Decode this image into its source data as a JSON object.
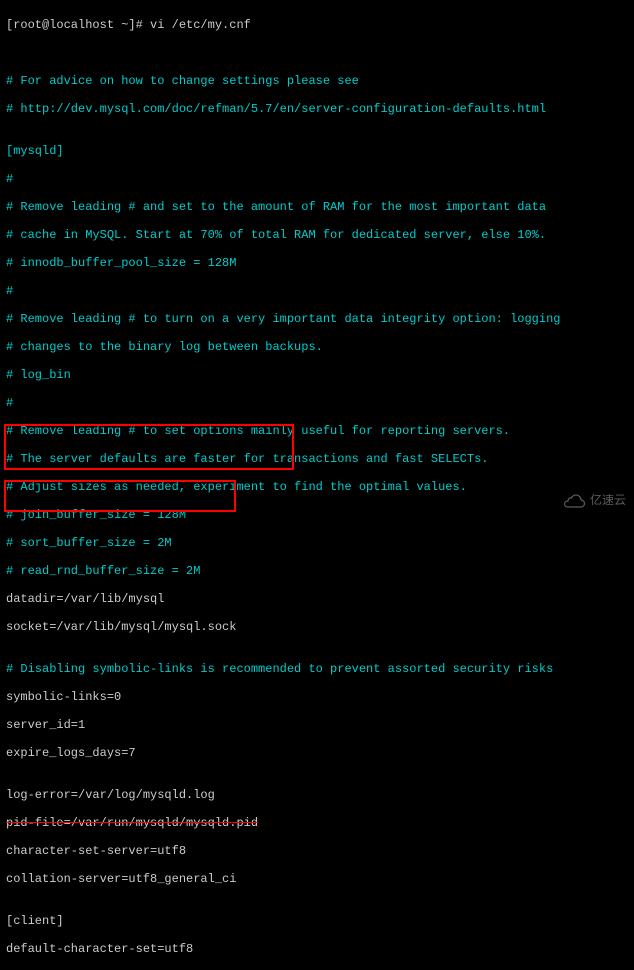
{
  "prompt": "[root@localhost ~]# vi /etc/my.cnf",
  "blank1": "",
  "blank2": "",
  "l1": "# For advice on how to change settings please see",
  "l2": "# http://dev.mysql.com/doc/refman/5.7/en/server-configuration-defaults.html",
  "l3": "",
  "l4": "[mysqld]",
  "l5": "#",
  "l6": "# Remove leading # and set to the amount of RAM for the most important data",
  "l7": "# cache in MySQL. Start at 70% of total RAM for dedicated server, else 10%.",
  "l8": "# innodb_buffer_pool_size = 128M",
  "l9": "#",
  "l10": "# Remove leading # to turn on a very important data integrity option: logging",
  "l11": "# changes to the binary log between backups.",
  "l12": "# log_bin",
  "l13": "#",
  "l14": "# Remove leading # to set options mainly useful for reporting servers.",
  "l15": "# The server defaults are faster for transactions and fast SELECTs.",
  "l16": "# Adjust sizes as needed, experiment to find the optimal values.",
  "l17": "# join_buffer_size = 128M",
  "l18": "# sort_buffer_size = 2M",
  "l19": "# read_rnd_buffer_size = 2M",
  "l20": "datadir=/var/lib/mysql",
  "l21": "socket=/var/lib/mysql/mysql.sock",
  "l22": "",
  "l23": "# Disabling symbolic-links is recommended to prevent assorted security risks",
  "l24": "symbolic-links=0",
  "l25": "server_id=1",
  "l26": "expire_logs_days=7",
  "l27": "",
  "l28": "log-error=/var/log/mysqld.log",
  "l29": "pid-file=/var/run/mysqld/mysqld.pid",
  "l30": "character-set-server=utf8",
  "l31": "collation-server=utf8_general_ci",
  "l32": "",
  "l33": "[client]",
  "l34": "default-character-set=utf8",
  "watermark_text": "亿速云"
}
